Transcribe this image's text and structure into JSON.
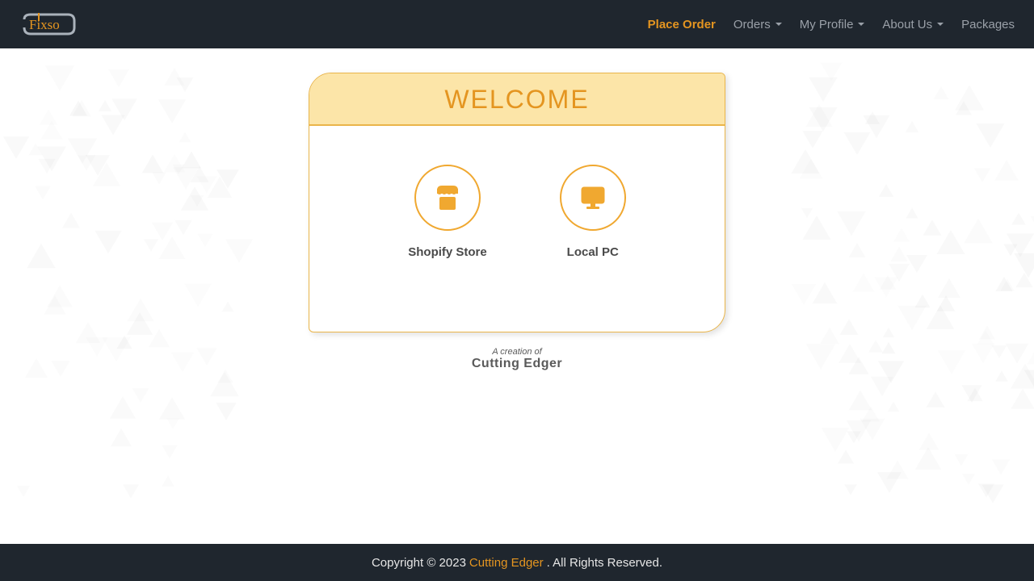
{
  "brand": {
    "name": "Fixso"
  },
  "nav": {
    "place_order": "Place Order",
    "orders": "Orders",
    "my_profile": "My Profile",
    "about_us": "About Us",
    "packages": "Packages"
  },
  "card": {
    "title": "WELCOME",
    "option_shopify": "Shopify Store",
    "option_localpc": "Local PC"
  },
  "creation": {
    "prefix": "A creation of",
    "name": "Cutting  Edger"
  },
  "footer": {
    "copyright_pre": "Copyright © 2023 ",
    "brand": "Cutting Edger",
    "copyright_post": ". All Rights Reserved."
  },
  "colors": {
    "accent": "#e49520",
    "accent_light": "#f0a830"
  }
}
